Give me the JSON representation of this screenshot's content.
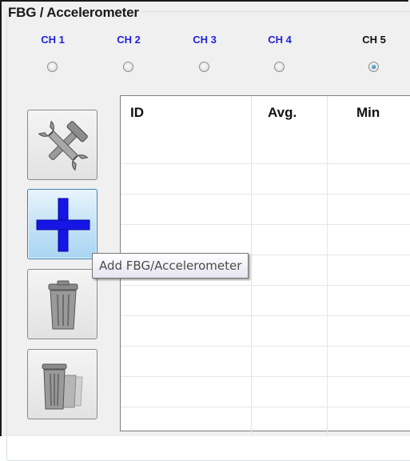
{
  "group": {
    "title": "FBG / Accelerometer"
  },
  "channels": [
    {
      "label": "CH 1",
      "selected": false
    },
    {
      "label": "CH 2",
      "selected": false
    },
    {
      "label": "CH 3",
      "selected": false
    },
    {
      "label": "CH 4",
      "selected": false
    },
    {
      "label": "CH 5",
      "selected": true
    }
  ],
  "colors": {
    "channel_label": "#2222dd",
    "channel_selected_label": "#111111",
    "add_icon": "#1515e6"
  },
  "toolbar": {
    "buttons": [
      {
        "icon": "tools-icon",
        "state": "normal"
      },
      {
        "icon": "plus-icon",
        "state": "hover"
      },
      {
        "icon": "trash-icon",
        "state": "disabled"
      },
      {
        "icon": "trash-multiple-icon",
        "state": "disabled"
      }
    ]
  },
  "tooltip": {
    "text": "Add FBG/Accelerometer"
  },
  "table": {
    "columns": [
      "ID",
      "Avg.",
      "Min"
    ],
    "rows": []
  }
}
